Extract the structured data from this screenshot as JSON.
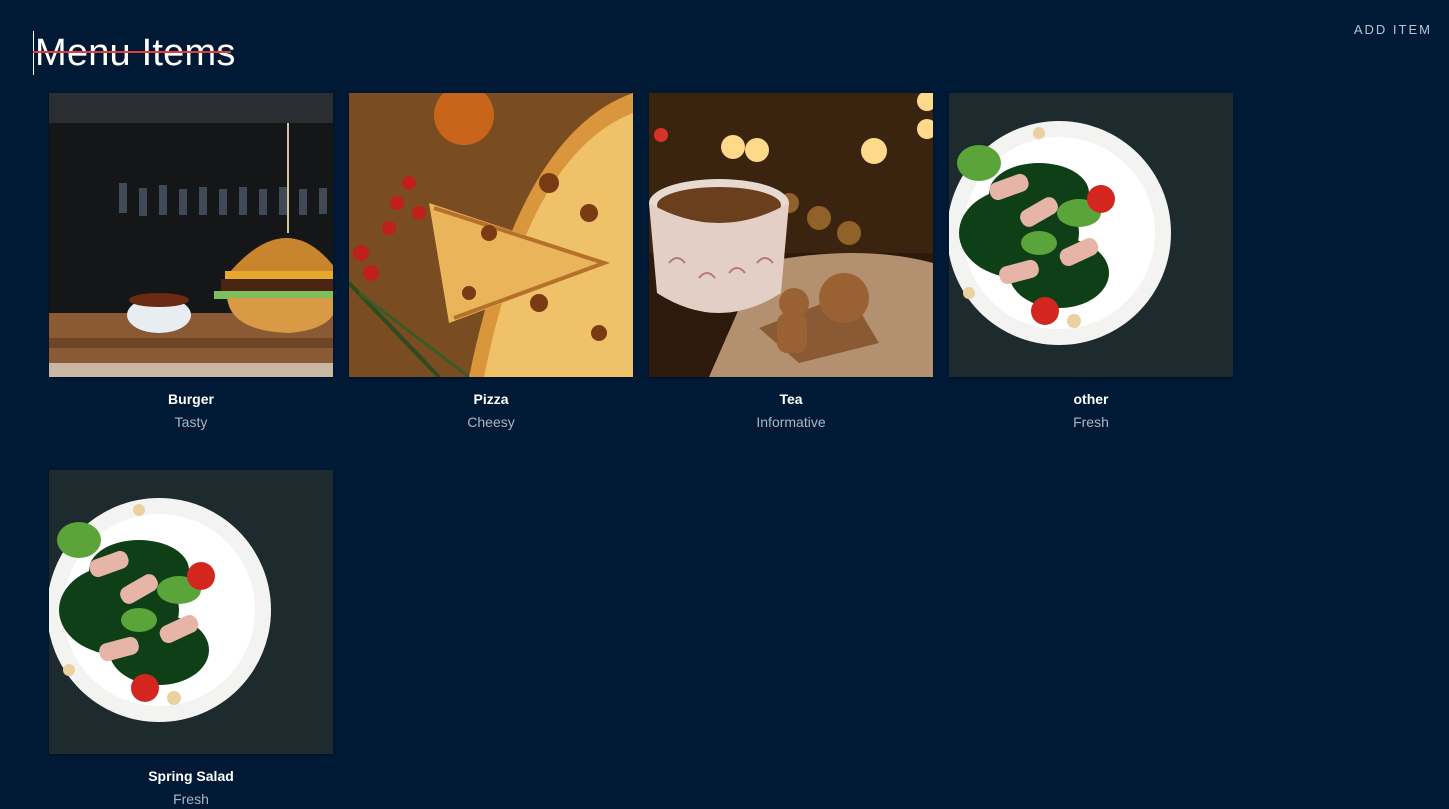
{
  "header": {
    "title": "Menu Items",
    "add_item_label": "ADD ITEM"
  },
  "items": [
    {
      "name": "Burger",
      "description": "Tasty",
      "image_icon": "burger-photo"
    },
    {
      "name": "Pizza",
      "description": "Cheesy",
      "image_icon": "pizza-photo"
    },
    {
      "name": "Tea",
      "description": "Informative",
      "image_icon": "tea-photo"
    },
    {
      "name": "other",
      "description": "Fresh",
      "image_icon": "salad-photo"
    },
    {
      "name": "Spring Salad",
      "description": "Fresh",
      "image_icon": "salad-photo"
    }
  ],
  "colors": {
    "background": "#001a36",
    "accent_underline": "#e83a3a",
    "muted_text": "#aab4c2"
  }
}
